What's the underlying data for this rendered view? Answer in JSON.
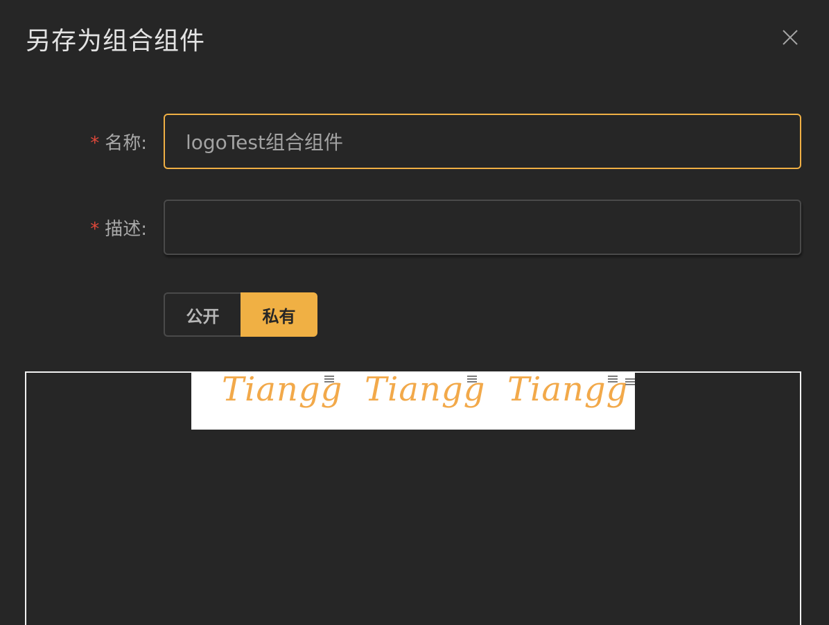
{
  "dialog": {
    "title": "另存为组合组件",
    "close_icon": "close-icon"
  },
  "form": {
    "name": {
      "required_mark": "*",
      "label": "名称:",
      "value": "logoTest组合组件"
    },
    "description": {
      "required_mark": "*",
      "label": "描述:",
      "value": ""
    }
  },
  "visibility": {
    "options": [
      "公开",
      "私有"
    ],
    "selected": "私有"
  },
  "preview": {
    "logos": [
      "Tiangg",
      "Tiangg",
      "Tiangg"
    ]
  },
  "colors": {
    "accent": "#f0b044",
    "background": "#262626",
    "required": "#e0483a",
    "logo_text": "#f2a94a"
  }
}
